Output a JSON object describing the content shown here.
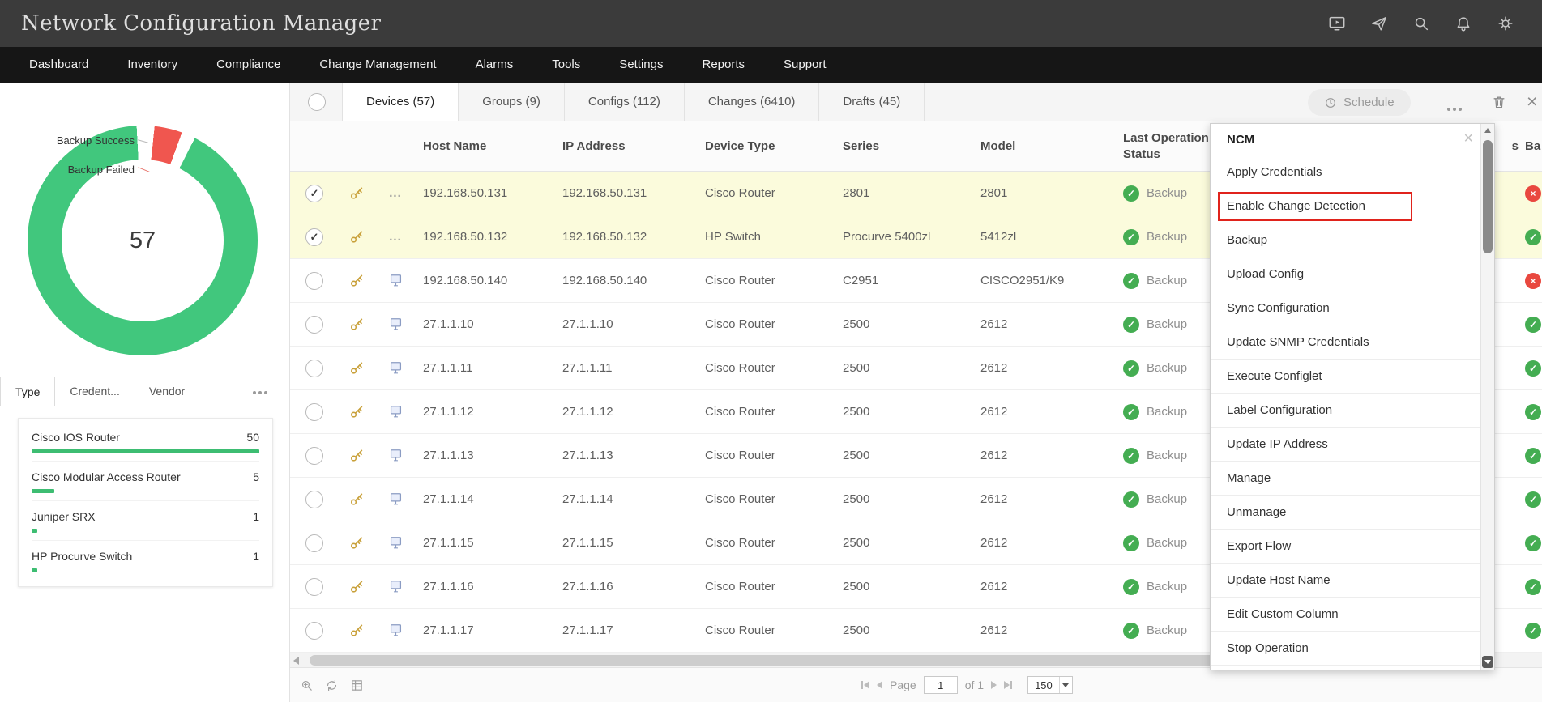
{
  "colors": {
    "success_green": "#41c77d",
    "failed_red": "#f0564f",
    "status_ok": "#44ad52",
    "status_failed": "#e9483f",
    "highlight_red": "#e0231c",
    "selected_row": "#fbfbdc",
    "bar_green": "#3dbd72"
  },
  "header": {
    "title": "Network Configuration Manager",
    "icons": [
      "demo-icon",
      "launch-icon",
      "search-icon",
      "notifications-icon",
      "settings-icon"
    ]
  },
  "nav": {
    "items": [
      "Dashboard",
      "Inventory",
      "Compliance",
      "Change Management",
      "Alarms",
      "Tools",
      "Settings",
      "Reports",
      "Support"
    ]
  },
  "sidebar": {
    "chart": {
      "total": "57",
      "legend_success": "Backup Success",
      "legend_failed": "Backup Failed"
    },
    "tabs": [
      {
        "label": "Type",
        "active": true
      },
      {
        "label": "Credent..."
      },
      {
        "label": "Vendor"
      }
    ],
    "device_types": [
      {
        "label": "Cisco IOS Router",
        "count": "50",
        "pct": 100
      },
      {
        "label": "Cisco Modular Access Router",
        "count": "5",
        "pct": 10
      },
      {
        "label": "Juniper SRX",
        "count": "1",
        "pct": 2.5
      },
      {
        "label": "HP Procurve Switch",
        "count": "1",
        "pct": 2.5
      }
    ]
  },
  "main": {
    "tabs": [
      {
        "label": "Devices (57)",
        "active": true
      },
      {
        "label": "Groups (9)"
      },
      {
        "label": "Configs (112)"
      },
      {
        "label": "Changes (6410)"
      },
      {
        "label": "Drafts (45)"
      }
    ],
    "toolbar": {
      "schedule_label": "Schedule"
    },
    "table": {
      "headers": {
        "host": "Host Name",
        "ip": "IP Address",
        "type": "Device Type",
        "series": "Series",
        "model": "Model",
        "status": "Last Operation Status",
        "fragment_s": "s",
        "fragment_ba": "Ba"
      },
      "rows": [
        {
          "host": "192.168.50.131",
          "ip": "192.168.50.131",
          "type": "Cisco Router",
          "series": "2801",
          "model": "2801",
          "op": "Backup",
          "checked": true,
          "icon2": "ellipsis",
          "backup": "failed"
        },
        {
          "host": "192.168.50.132",
          "ip": "192.168.50.132",
          "type": "HP Switch",
          "series": "Procurve 5400zl",
          "model": "5412zl",
          "op": "Backup",
          "checked": true,
          "icon2": "ellipsis",
          "backup": "ok"
        },
        {
          "host": "192.168.50.140",
          "ip": "192.168.50.140",
          "type": "Cisco Router",
          "series": "C2951",
          "model": "CISCO2951/K9",
          "op": "Backup",
          "checked": false,
          "icon2": "device",
          "backup": "failed"
        },
        {
          "host": "27.1.1.10",
          "ip": "27.1.1.10",
          "type": "Cisco Router",
          "series": "2500",
          "model": "2612",
          "op": "Backup",
          "checked": false,
          "icon2": "device",
          "backup": "ok"
        },
        {
          "host": "27.1.1.11",
          "ip": "27.1.1.11",
          "type": "Cisco Router",
          "series": "2500",
          "model": "2612",
          "op": "Backup",
          "checked": false,
          "icon2": "device",
          "backup": "ok"
        },
        {
          "host": "27.1.1.12",
          "ip": "27.1.1.12",
          "type": "Cisco Router",
          "series": "2500",
          "model": "2612",
          "op": "Backup",
          "checked": false,
          "icon2": "device",
          "backup": "ok"
        },
        {
          "host": "27.1.1.13",
          "ip": "27.1.1.13",
          "type": "Cisco Router",
          "series": "2500",
          "model": "2612",
          "op": "Backup",
          "checked": false,
          "icon2": "device",
          "backup": "ok"
        },
        {
          "host": "27.1.1.14",
          "ip": "27.1.1.14",
          "type": "Cisco Router",
          "series": "2500",
          "model": "2612",
          "op": "Backup",
          "checked": false,
          "icon2": "device",
          "backup": "ok"
        },
        {
          "host": "27.1.1.15",
          "ip": "27.1.1.15",
          "type": "Cisco Router",
          "series": "2500",
          "model": "2612",
          "op": "Backup",
          "checked": false,
          "icon2": "device",
          "backup": "ok"
        },
        {
          "host": "27.1.1.16",
          "ip": "27.1.1.16",
          "type": "Cisco Router",
          "series": "2500",
          "model": "2612",
          "op": "Backup",
          "checked": false,
          "icon2": "device",
          "backup": "ok"
        },
        {
          "host": "27.1.1.17",
          "ip": "27.1.1.17",
          "type": "Cisco Router",
          "series": "2500",
          "model": "2612",
          "op": "Backup",
          "checked": false,
          "icon2": "device",
          "backup": "ok"
        }
      ]
    },
    "pagination": {
      "page_label": "Page",
      "page_value": "1",
      "of_label": "of 1",
      "size_value": "150"
    },
    "footer_icons": [
      "zoom-icon",
      "sync-icon",
      "grid-icon"
    ]
  },
  "menu": {
    "title": "NCM",
    "close_label": "×",
    "items": [
      {
        "label": "Apply Credentials"
      },
      {
        "label": "Enable Change Detection",
        "highlighted": true
      },
      {
        "label": "Backup"
      },
      {
        "label": "Upload Config"
      },
      {
        "label": "Sync Configuration"
      },
      {
        "label": "Update SNMP Credentials"
      },
      {
        "label": "Execute Configlet"
      },
      {
        "label": "Label Configuration"
      },
      {
        "label": "Update IP Address"
      },
      {
        "label": "Manage"
      },
      {
        "label": "Unmanage"
      },
      {
        "label": "Export Flow"
      },
      {
        "label": "Update Host Name"
      },
      {
        "label": "Edit Custom Column"
      },
      {
        "label": "Stop Operation"
      }
    ]
  }
}
